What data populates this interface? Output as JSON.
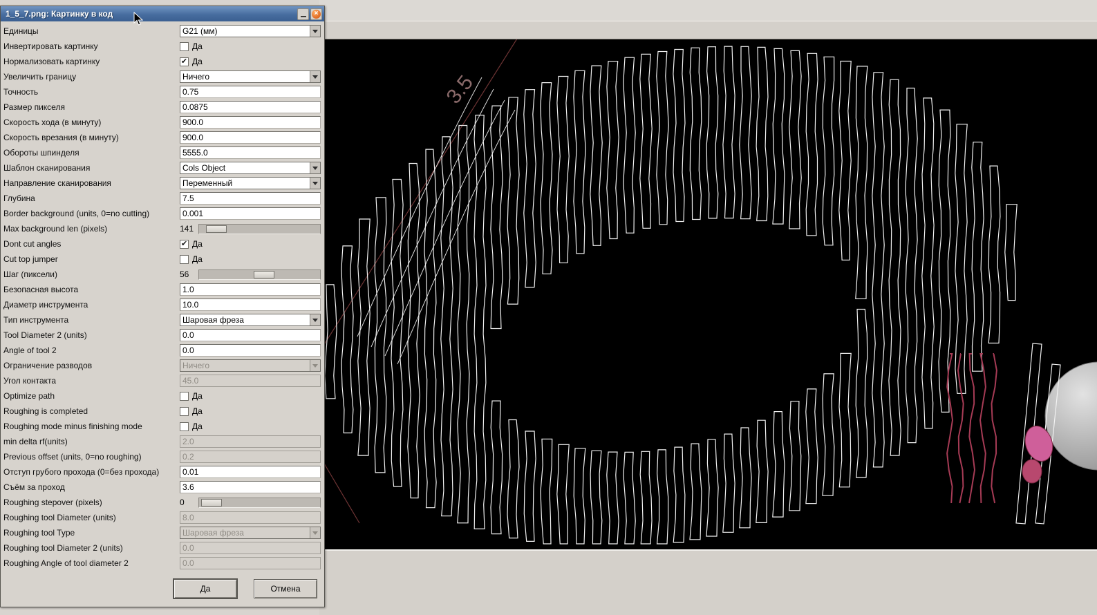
{
  "window": {
    "title": "1_5_7.png: Картинку в код"
  },
  "dialog": {
    "ok_label": "Да",
    "cancel_label": "Отмена",
    "rows": [
      {
        "label": "Единицы",
        "type": "combo",
        "value": "G21 (мм)",
        "enabled": true
      },
      {
        "label": "Инвертировать картинку",
        "type": "check",
        "text": "Да",
        "checked": false
      },
      {
        "label": "Нормализовать картинку",
        "type": "check",
        "text": "Да",
        "checked": true
      },
      {
        "label": "Увеличить границу",
        "type": "combo",
        "value": "Ничего",
        "enabled": true
      },
      {
        "label": "Точность",
        "type": "entry",
        "value": "0.75",
        "enabled": true
      },
      {
        "label": "Размер пикселя",
        "type": "entry",
        "value": "0.0875",
        "enabled": true
      },
      {
        "label": "Скорость хода (в минуту)",
        "type": "entry",
        "value": "900.0",
        "enabled": true
      },
      {
        "label": "Скорость врезания (в минуту)",
        "type": "entry",
        "value": "900.0",
        "enabled": true
      },
      {
        "label": "Обороты шпинделя",
        "type": "entry",
        "value": "5555.0",
        "enabled": true
      },
      {
        "label": "Шаблон сканирования",
        "type": "combo",
        "value": "Cols Object",
        "enabled": true
      },
      {
        "label": "Направление сканирования",
        "type": "combo",
        "value": "Переменный",
        "enabled": true
      },
      {
        "label": "Глубина",
        "type": "entry",
        "value": "7.5",
        "enabled": true
      },
      {
        "label": "Border background (units, 0=no cutting)",
        "type": "entry",
        "value": "0.001",
        "enabled": true
      },
      {
        "label": "Max background len (pixels)",
        "type": "slider",
        "value": "141",
        "pos": 0.07
      },
      {
        "label": "Dont cut angles",
        "type": "check",
        "text": "Да",
        "checked": true
      },
      {
        "label": "Cut top jumper",
        "type": "check",
        "text": "Да",
        "checked": false
      },
      {
        "label": "Шаг (пиксели)",
        "type": "slider",
        "value": "56",
        "pos": 0.55
      },
      {
        "label": "Безопасная высота",
        "type": "entry",
        "value": "1.0",
        "enabled": true
      },
      {
        "label": "Диаметр инструмента",
        "type": "entry",
        "value": "10.0",
        "enabled": true
      },
      {
        "label": "Тип инструмента",
        "type": "combo",
        "value": "Шаровая фреза",
        "enabled": true
      },
      {
        "label": "Tool Diameter 2 (units)",
        "type": "entry",
        "value": "0.0",
        "enabled": true
      },
      {
        "label": "Angle of tool 2",
        "type": "entry",
        "value": "0.0",
        "enabled": true
      },
      {
        "label": "Ограничение разводов",
        "type": "combo",
        "value": "Ничего",
        "enabled": false
      },
      {
        "label": "Угол контакта",
        "type": "entry",
        "value": "45.0",
        "enabled": false
      },
      {
        "label": "Optimize path",
        "type": "check",
        "text": "Да",
        "checked": false
      },
      {
        "label": "Roughing is completed",
        "type": "check",
        "text": "Да",
        "checked": false
      },
      {
        "label": "Roughing mode minus finishing mode",
        "type": "check",
        "text": "Да",
        "checked": false
      },
      {
        "label": "min delta rf(units)",
        "type": "entry",
        "value": "2.0",
        "enabled": false
      },
      {
        "label": "Previous offset (units, 0=no roughing)",
        "type": "entry",
        "value": "0.2",
        "enabled": false
      },
      {
        "label": "Отступ грубого прохода (0=без прохода)",
        "type": "entry",
        "value": "0.01",
        "enabled": true
      },
      {
        "label": "Съём за проход",
        "type": "entry",
        "value": "3.6",
        "enabled": true
      },
      {
        "label": "Roughing stepover (pixels)",
        "type": "slider",
        "value": "0",
        "pos": 0.02
      },
      {
        "label": "Roughing tool Diameter (units)",
        "type": "entry",
        "value": "8.0",
        "enabled": false
      },
      {
        "label": "Roughing tool Type",
        "type": "combo",
        "value": "Шаровая фреза",
        "enabled": false
      },
      {
        "label": "Roughing tool Diameter 2 (units)",
        "type": "entry",
        "value": "0.0",
        "enabled": false
      },
      {
        "label": "Roughing Angle of tool diameter 2",
        "type": "entry",
        "value": "0.0",
        "enabled": false
      }
    ]
  },
  "canvas": {
    "dim_label": "3.5",
    "background": "#000000",
    "colors": {
      "toolpath": "#f2f2f2",
      "roughing": "#a63b55",
      "marker": "#cf5f9a",
      "marker_dark": "#b8486e",
      "marker_edge": "#7e2742",
      "ball_light": "#e2e2e2",
      "ball_dark": "#8f8f8f",
      "dim_line": "#6e3434",
      "dim_text": "#8a6a6a"
    }
  }
}
